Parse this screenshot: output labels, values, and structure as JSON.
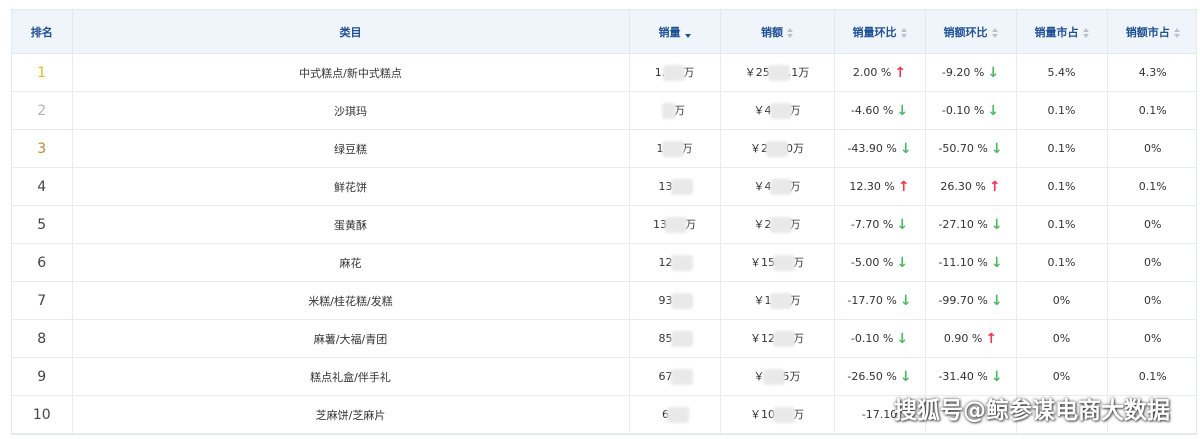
{
  "table": {
    "headers": {
      "rank": "排名",
      "category": "类目",
      "sales_volume": "销量",
      "sales_amount": "销额",
      "volume_mom": "销量环比",
      "amount_mom": "销额环比",
      "volume_share": "销量市占",
      "amount_share": "销额市占"
    },
    "sorted_by": "销量",
    "rows": [
      {
        "rank": "1",
        "category": "中式糕点/新中式糕点",
        "volume_pre": "1.",
        "volume_post": "万",
        "amount_pre": "￥25",
        "amount_post": ".1万",
        "volume_mom": "2.00 %",
        "volume_dir": "up",
        "amount_mom": "-9.20 %",
        "amount_dir": "down",
        "volume_share": "5.4%",
        "amount_share": "4.3%"
      },
      {
        "rank": "2",
        "category": "沙琪玛",
        "volume_pre": "",
        "volume_post": "万",
        "amount_pre": "￥4",
        "amount_post": "万",
        "volume_mom": "-4.60 %",
        "volume_dir": "down",
        "amount_mom": "-0.10 %",
        "amount_dir": "down",
        "volume_share": "0.1%",
        "amount_share": "0.1%"
      },
      {
        "rank": "3",
        "category": "绿豆糕",
        "volume_pre": "1",
        "volume_post": "万",
        "amount_pre": "￥2",
        "amount_post": "0万",
        "volume_mom": "-43.90 %",
        "volume_dir": "down",
        "amount_mom": "-50.70 %",
        "amount_dir": "down",
        "volume_share": "0.1%",
        "amount_share": "0%"
      },
      {
        "rank": "4",
        "category": "鲜花饼",
        "volume_pre": "13",
        "volume_post": "",
        "amount_pre": "￥4",
        "amount_post": "万",
        "volume_mom": "12.30 %",
        "volume_dir": "up",
        "amount_mom": "26.30 %",
        "amount_dir": "up",
        "volume_share": "0.1%",
        "amount_share": "0.1%"
      },
      {
        "rank": "5",
        "category": "蛋黄酥",
        "volume_pre": "13",
        "volume_post": "万",
        "amount_pre": "￥2",
        "amount_post": "万",
        "volume_mom": "-7.70 %",
        "volume_dir": "down",
        "amount_mom": "-27.10 %",
        "amount_dir": "down",
        "volume_share": "0.1%",
        "amount_share": "0%"
      },
      {
        "rank": "6",
        "category": "麻花",
        "volume_pre": "12",
        "volume_post": "",
        "amount_pre": "￥15",
        "amount_post": "万",
        "volume_mom": "-5.00 %",
        "volume_dir": "down",
        "amount_mom": "-11.10 %",
        "amount_dir": "down",
        "volume_share": "0.1%",
        "amount_share": "0%"
      },
      {
        "rank": "7",
        "category": "米糕/桂花糕/发糕",
        "volume_pre": "93",
        "volume_post": "",
        "amount_pre": "￥1",
        "amount_post": "万",
        "volume_mom": "-17.70 %",
        "volume_dir": "down",
        "amount_mom": "-99.70 %",
        "amount_dir": "down",
        "volume_share": "0%",
        "amount_share": "0%"
      },
      {
        "rank": "8",
        "category": "麻薯/大福/青团",
        "volume_pre": "85",
        "volume_post": "",
        "amount_pre": "￥12",
        "amount_post": "万",
        "volume_mom": "-0.10 %",
        "volume_dir": "down",
        "amount_mom": "0.90 %",
        "amount_dir": "up",
        "volume_share": "0%",
        "amount_share": "0%"
      },
      {
        "rank": "9",
        "category": "糕点礼盒/伴手礼",
        "volume_pre": "67",
        "volume_post": "",
        "amount_pre": "￥",
        "amount_post": "5万",
        "volume_mom": "-26.50 %",
        "volume_dir": "down",
        "amount_mom": "-31.40 %",
        "amount_dir": "down",
        "volume_share": "0%",
        "amount_share": "0.1%"
      },
      {
        "rank": "10",
        "category": "芝麻饼/芝麻片",
        "volume_pre": "6",
        "volume_post": "",
        "amount_pre": "￥10",
        "amount_post": "万",
        "volume_mom": "-17.10",
        "volume_dir": "",
        "amount_mom": "",
        "amount_dir": "",
        "volume_share": "",
        "amount_share": ""
      }
    ]
  },
  "watermark": "搜狐号@鲸参谋电商大数据",
  "colors": {
    "header_text": "#1f4f96",
    "header_bg": "#f0f5fc",
    "up": "#f0384e",
    "down": "#4cb963",
    "rank1": "#e8b526",
    "rank2": "#b3b3b3",
    "rank3": "#c28b33"
  },
  "icons": {
    "up": "arrow-up-icon",
    "down": "arrow-down-icon",
    "sort": "sort-caret-icon"
  }
}
